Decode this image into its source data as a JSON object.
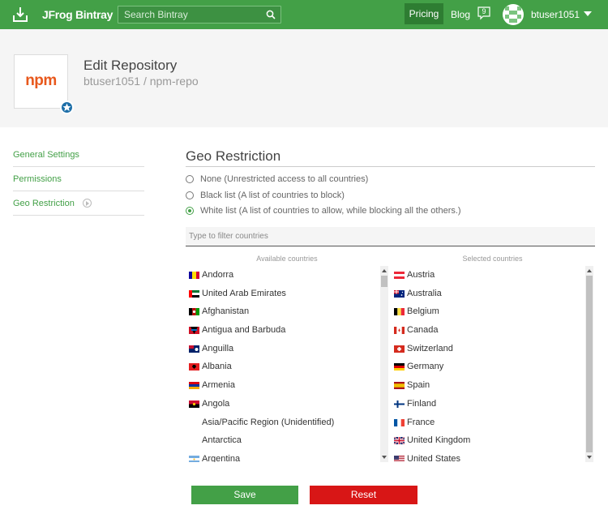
{
  "topbar": {
    "brand": "JFrog Bintray",
    "search_placeholder": "Search Bintray",
    "pricing": "Pricing",
    "blog": "Blog",
    "notifications_count": "9",
    "username": "btuser1051",
    "accent_color": "#43a047"
  },
  "header": {
    "package_logo_text": "npm",
    "title": "Edit Repository",
    "repo_path": "btuser1051 / npm-repo"
  },
  "sidebar": {
    "items": [
      {
        "label": "General Settings"
      },
      {
        "label": "Permissions"
      },
      {
        "label": "Geo Restriction",
        "active": true
      }
    ]
  },
  "geo": {
    "title": "Geo Restriction",
    "options": [
      {
        "label": "None (Unrestricted access to all countries)",
        "checked": false
      },
      {
        "label": "Black list (A list of countries to block)",
        "checked": false
      },
      {
        "label": "White list (A list of countries to allow, while blocking all the others.)",
        "checked": true
      }
    ],
    "filter_placeholder": "Type to filter countries",
    "available_label": "Available countries",
    "selected_label": "Selected countries",
    "available": [
      {
        "name": "Andorra",
        "flag": "ad"
      },
      {
        "name": "United Arab Emirates",
        "flag": "ae"
      },
      {
        "name": "Afghanistan",
        "flag": "af"
      },
      {
        "name": "Antigua and Barbuda",
        "flag": "ag"
      },
      {
        "name": "Anguilla",
        "flag": "ai"
      },
      {
        "name": "Albania",
        "flag": "al"
      },
      {
        "name": "Armenia",
        "flag": "am"
      },
      {
        "name": "Angola",
        "flag": "ao"
      },
      {
        "name": "Asia/Pacific Region (Unidentified)",
        "flag": ""
      },
      {
        "name": "Antarctica",
        "flag": ""
      },
      {
        "name": "Argentina",
        "flag": "ar"
      }
    ],
    "selected": [
      {
        "name": "Austria",
        "flag": "at"
      },
      {
        "name": "Australia",
        "flag": "au"
      },
      {
        "name": "Belgium",
        "flag": "be"
      },
      {
        "name": "Canada",
        "flag": "ca"
      },
      {
        "name": "Switzerland",
        "flag": "ch"
      },
      {
        "name": "Germany",
        "flag": "de"
      },
      {
        "name": "Spain",
        "flag": "es"
      },
      {
        "name": "Finland",
        "flag": "fi"
      },
      {
        "name": "France",
        "flag": "fr"
      },
      {
        "name": "United Kingdom",
        "flag": "gb"
      },
      {
        "name": "United States",
        "flag": "us"
      }
    ],
    "available_scroll": 0.0,
    "selected_scroll": 0.0
  },
  "actions": {
    "save": "Save",
    "reset": "Reset",
    "save_color": "#43a047",
    "reset_color": "#d81616"
  }
}
